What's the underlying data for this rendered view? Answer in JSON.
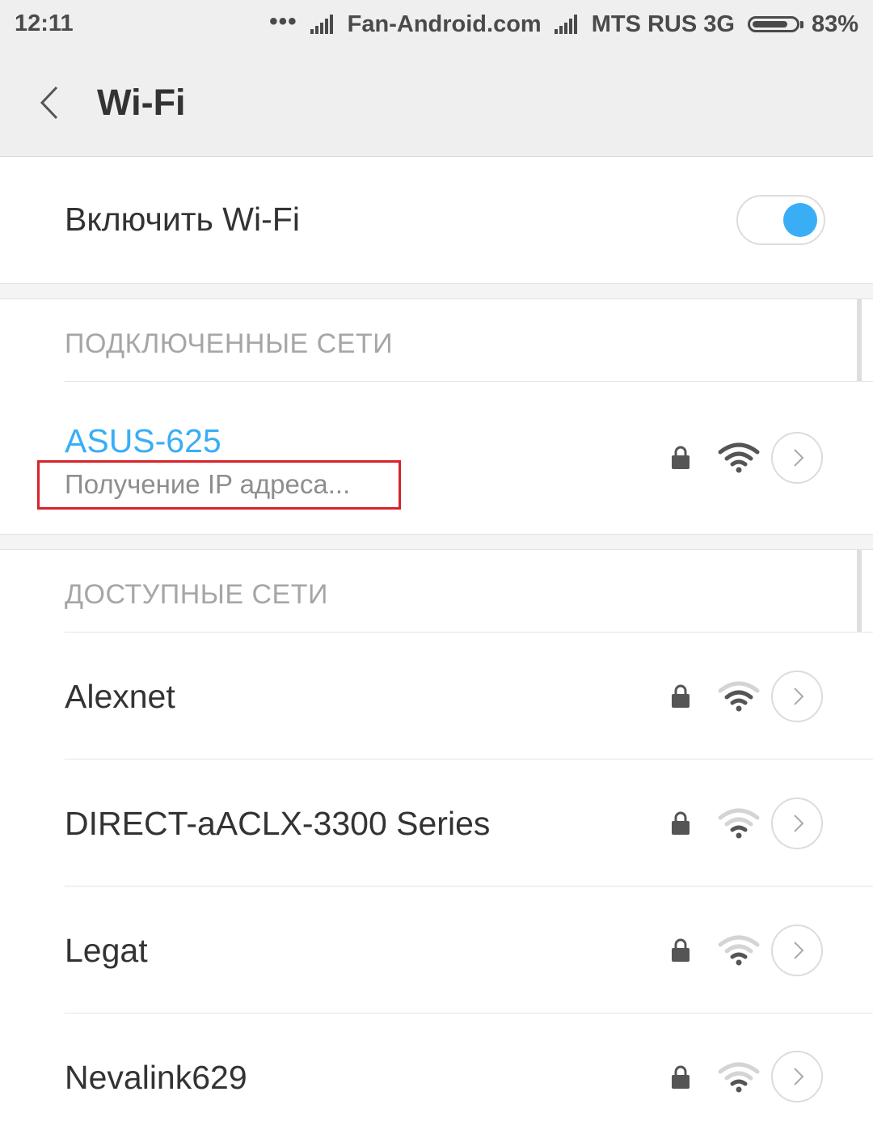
{
  "status_bar": {
    "time": "12:11",
    "dots": "•••",
    "carrier1": "Fan-Android.com",
    "carrier2": "MTS RUS 3G",
    "battery_percent": "83%",
    "battery_level": 0.83
  },
  "header": {
    "title": "Wi-Fi"
  },
  "wifi_toggle": {
    "label": "Включить Wi-Fi",
    "state": "on",
    "accent": "#3aaef5"
  },
  "connected_section": {
    "title": "ПОДКЛЮЧЕННЫЕ СЕТИ",
    "network": {
      "name": "ASUS-625",
      "status": "Получение IP адреса...",
      "secured": true,
      "signal": "strong"
    }
  },
  "available_section": {
    "title": "ДОСТУПНЫЕ СЕТИ",
    "networks": [
      {
        "name": "Alexnet",
        "secured": true,
        "signal": "medium"
      },
      {
        "name": "DIRECT-aACLX-3300 Series",
        "secured": true,
        "signal": "weak"
      },
      {
        "name": "Legat",
        "secured": true,
        "signal": "weak"
      },
      {
        "name": "Nevalink629",
        "secured": true,
        "signal": "weak"
      }
    ]
  },
  "colors": {
    "accent": "#3aaef5",
    "highlight": "#d8232a"
  },
  "icons": {
    "back": "chevron-left-icon",
    "lock": "lock-icon",
    "wifi": "wifi-signal-icon",
    "detail": "chevron-right-icon"
  }
}
